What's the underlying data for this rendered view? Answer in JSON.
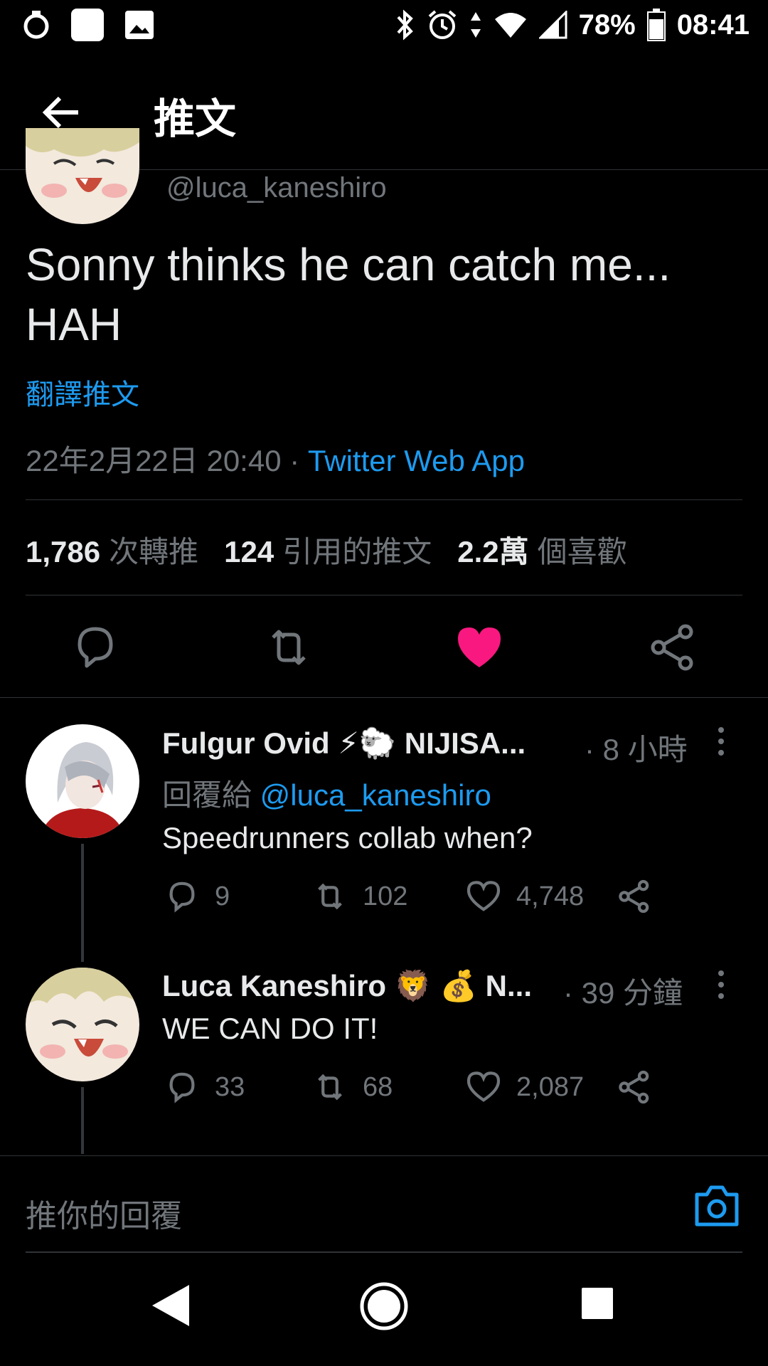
{
  "status_bar": {
    "battery": "78%",
    "time": "08:41"
  },
  "header": {
    "title": "推文"
  },
  "main_tweet": {
    "handle": "@luca_kaneshiro",
    "text": "Sonny thinks he can catch me... HAH",
    "translate_label": "翻譯推文",
    "timestamp": "22年2月22日 20:40",
    "separator": " · ",
    "source": "Twitter Web App",
    "stats": {
      "retweets_value": "1,786",
      "retweets_label": "次轉推",
      "quotes_value": "124",
      "quotes_label": "引用的推文",
      "likes_value": "2.2萬",
      "likes_label": "個喜歡"
    },
    "liked": true
  },
  "replies": [
    {
      "name": "Fulgur Ovid ⚡🐑 NIJISA...",
      "time": "· 8 小時",
      "reply_to_label": "回覆給 ",
      "reply_to_handle": "@luca_kaneshiro",
      "text": "Speedrunners collab when?",
      "reply_count": "9",
      "retweet_count": "102",
      "like_count": "4,748"
    },
    {
      "name": "Luca Kaneshiro 🦁 💰 N...",
      "time": "· 39 分鐘",
      "text": "WE CAN DO IT!",
      "reply_count": "33",
      "retweet_count": "68",
      "like_count": "2,087"
    }
  ],
  "reply_bar": {
    "placeholder": "推你的回覆"
  },
  "colors": {
    "accent": "#1d9bf0",
    "like": "#f91880",
    "muted": "#71767b",
    "background": "#000000"
  }
}
